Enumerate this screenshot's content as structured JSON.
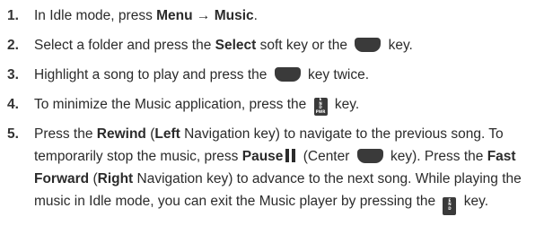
{
  "steps": [
    {
      "number": "1.",
      "parts": [
        "In Idle mode, press ",
        "Menu → Music",
        "."
      ]
    },
    {
      "number": "2.",
      "parts": [
        "Select a folder and press the ",
        "Select",
        " soft key or the ",
        " key."
      ]
    },
    {
      "number": "3.",
      "parts": [
        "Highlight a song to play and press the ",
        " key twice."
      ]
    },
    {
      "number": "4.",
      "parts": [
        "To minimize the Music application, press the ",
        " key."
      ]
    },
    {
      "number": "5.",
      "lines": [
        [
          "Press the ",
          "Rewind",
          " (",
          "Left",
          " Navigation key) to navigate to the previous song. To"
        ],
        [
          "temporarily stop the music, press ",
          "Pause",
          " (Center ",
          " key). Press the ",
          "Fast"
        ],
        [
          "Forward",
          " (",
          "Right",
          " Navigation key) to advance to the next song. While playing the"
        ],
        [
          "music in Idle mode, you can exit the Music player by pressing the ",
          " key."
        ]
      ]
    }
  ],
  "icons": {
    "select_key": "select-key-icon",
    "end_key": "end-pwr-key-icon",
    "pause": "pause-icon"
  },
  "end_key_label": [
    "E",
    "N",
    "D",
    "PWR"
  ],
  "end_key_label_short": [
    "E",
    "N",
    "D"
  ]
}
